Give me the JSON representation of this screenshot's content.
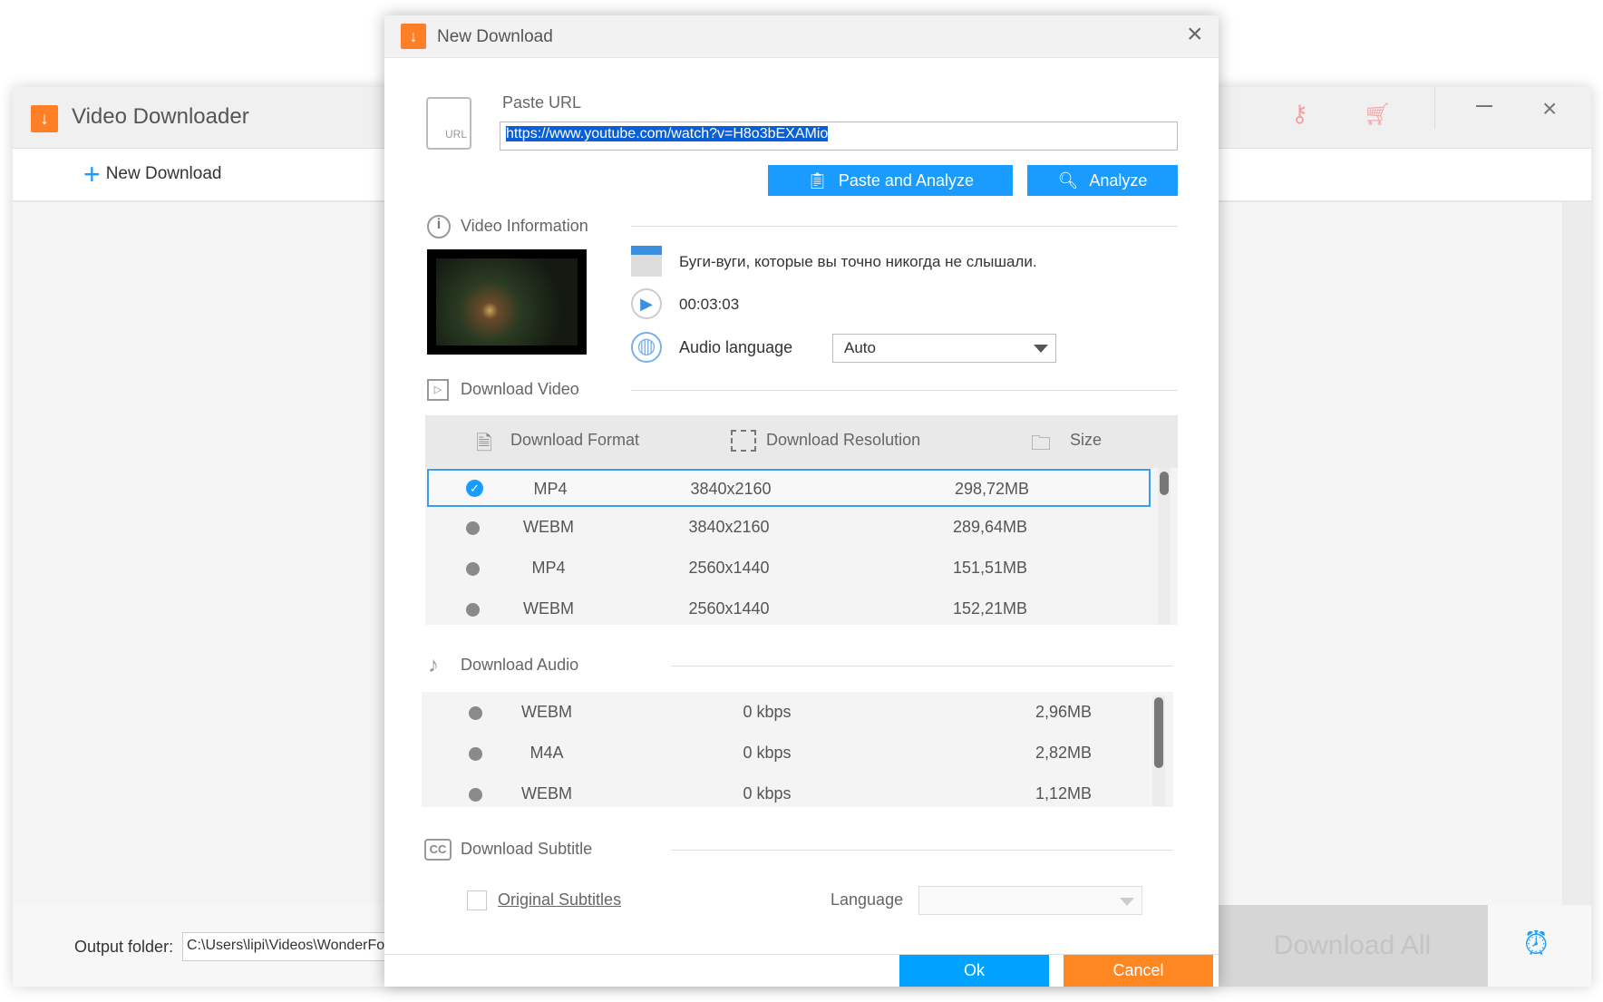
{
  "main_window": {
    "title": "Video Downloader",
    "toolbar": {
      "new_download": "New Download"
    },
    "title_icons": [
      "key-icon",
      "cart-icon",
      "minimize-icon",
      "close-icon"
    ],
    "bottom": {
      "output_folder_label": "Output folder:",
      "output_folder_value": "C:\\Users\\lipi\\Videos\\WonderFo",
      "download_all": "Download All"
    }
  },
  "dialog": {
    "title": "New Download",
    "paste_url_label": "Paste URL",
    "url_value": "https://www.youtube.com/watch?v=H8o3bEXAMio",
    "url_icon_text": "URL",
    "paste_analyze": "Paste and Analyze",
    "analyze": "Analyze",
    "video_info": {
      "heading": "Video Information",
      "title": "Буги-вуги, которые вы точно никогда не слышали.",
      "duration": "00:03:03",
      "audio_language_label": "Audio language",
      "audio_language_value": "Auto"
    },
    "download_video": {
      "heading": "Download Video",
      "columns": [
        "Download Format",
        "Download Resolution",
        "Size"
      ],
      "rows": [
        {
          "format": "MP4",
          "resolution": "3840x2160",
          "size": "298,72MB",
          "selected": true
        },
        {
          "format": "WEBM",
          "resolution": "3840x2160",
          "size": "289,64MB",
          "selected": false
        },
        {
          "format": "MP4",
          "resolution": "2560x1440",
          "size": "151,51MB",
          "selected": false
        },
        {
          "format": "WEBM",
          "resolution": "2560x1440",
          "size": "152,21MB",
          "selected": false
        }
      ]
    },
    "download_audio": {
      "heading": "Download Audio",
      "rows": [
        {
          "format": "WEBM",
          "bitrate": "0 kbps",
          "size": "2,96MB"
        },
        {
          "format": "M4A",
          "bitrate": "0 kbps",
          "size": "2,82MB"
        },
        {
          "format": "WEBM",
          "bitrate": "0 kbps",
          "size": "1,12MB"
        }
      ]
    },
    "download_subtitle": {
      "heading": "Download Subtitle",
      "icon_text": "CC",
      "original_subtitles": "Original Subtitles",
      "original_checked": false,
      "language_label": "Language",
      "language_value": ""
    },
    "ok": "Ok",
    "cancel": "Cancel"
  },
  "colors": {
    "accent": "#1a9cff",
    "orange": "#ff7f27"
  }
}
